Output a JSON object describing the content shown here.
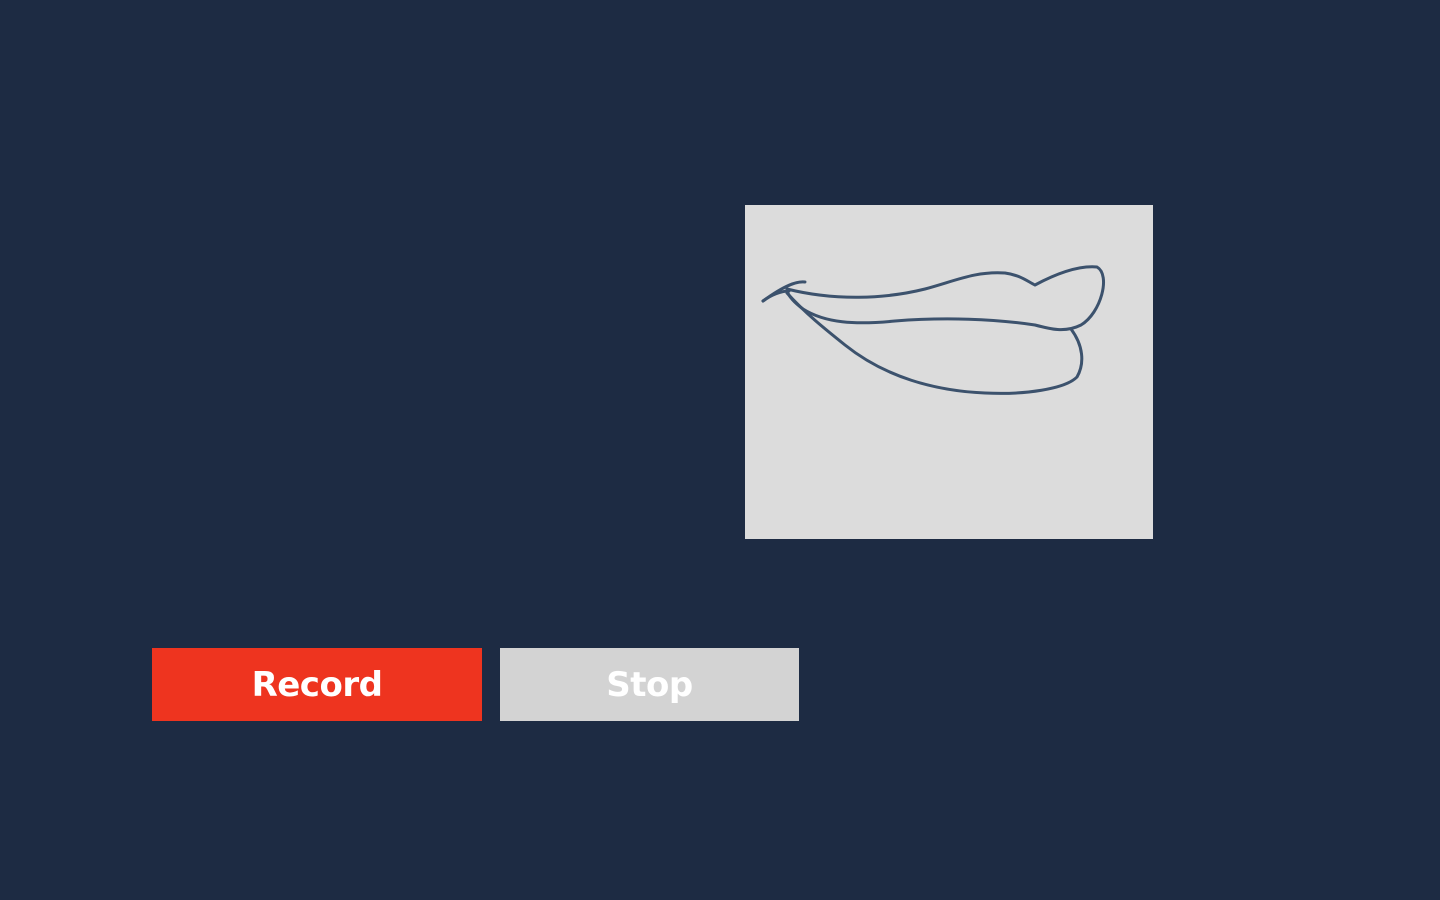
{
  "colors": {
    "background": "#1d2b43",
    "preview_background": "#dcdcdc",
    "sketch_stroke": "#3c526d",
    "record_button": "#ee341f",
    "stop_button": "#d3d3d3",
    "button_text": "#ffffff"
  },
  "preview": {
    "content": "lips-sketch"
  },
  "controls": {
    "record_label": "Record",
    "stop_label": "Stop"
  }
}
